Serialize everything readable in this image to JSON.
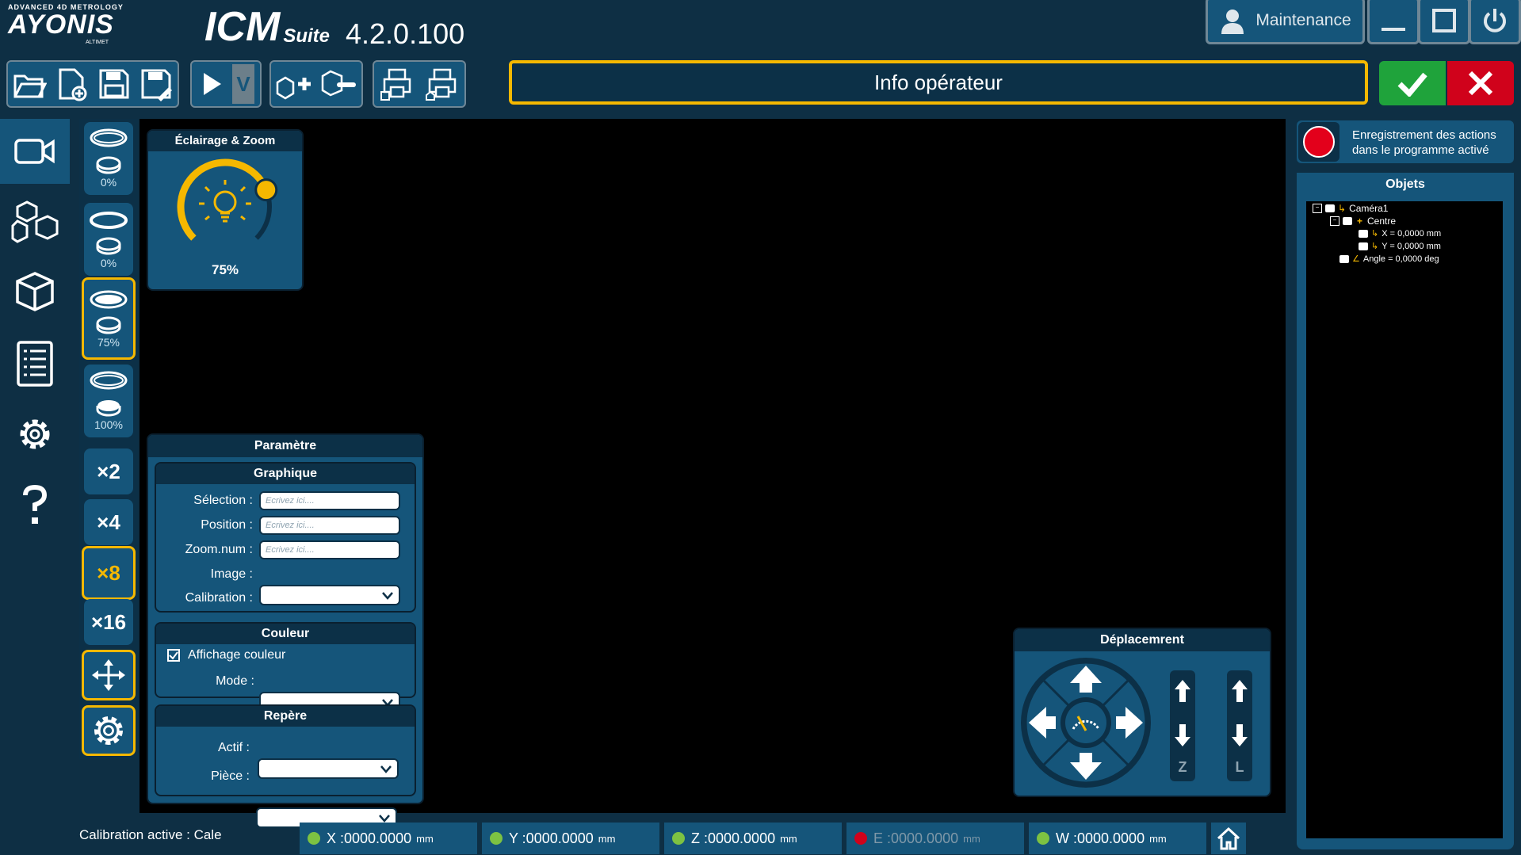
{
  "brand": {
    "tagline": "ADVANCED 4D METROLOGY",
    "logo": "AYONIS",
    "sublogo": "ALTIMET",
    "suite": "ICM",
    "suite_sub": "Suite",
    "version": "4.2.0.100"
  },
  "window": {
    "user_label": "Maintenance"
  },
  "toolbar": {
    "run_version": "V"
  },
  "operator_info": "Info opérateur",
  "lighting": {
    "title": "Éclairage & Zoom",
    "level": "75%",
    "level_value": 0.75,
    "lamps": [
      "0%",
      "0%",
      "75%",
      "100%"
    ],
    "zooms": [
      "×2",
      "×4",
      "×8",
      "×16"
    ]
  },
  "params": {
    "title": "Paramètre",
    "graphique": {
      "title": "Graphique",
      "selection_label": "Sélection :",
      "position_label": "Position :",
      "zoom_label": "Zoom.num :",
      "image_label": "Image :",
      "calibration_label": "Calibration :",
      "placeholder": "Ecrivez ici...."
    },
    "couleur": {
      "title": "Couleur",
      "affichage_label": "Affichage couleur",
      "mode_label": "Mode :"
    },
    "repere": {
      "title": "Repère",
      "actif_label": "Actif :",
      "piece_label": "Pièce :"
    }
  },
  "move": {
    "title": "Déplacemrent",
    "z_label": "Z",
    "l_label": "L"
  },
  "recording": {
    "line1": "Enregistrement des actions",
    "line2": "dans le programme activé"
  },
  "objects": {
    "title": "Objets",
    "items": [
      "Caméra1",
      "Centre",
      "X = 0,0000 mm",
      "Y = 0,0000 mm",
      "Angle = 0,0000 deg"
    ]
  },
  "statusbar": {
    "calibration": "Calibration active : Cale",
    "unit": "mm",
    "axes": [
      {
        "label": "X :0000.0000",
        "color": "#7dc242"
      },
      {
        "label": "Y :0000.0000",
        "color": "#7dc242"
      },
      {
        "label": "Z :0000.0000",
        "color": "#7dc242"
      },
      {
        "label": "E :0000.0000",
        "color": "#d0021b"
      },
      {
        "label": "W :0000.0000",
        "color": "#7dc242"
      }
    ]
  },
  "colors": {
    "accent": "#f5b800",
    "panel": "#15557a",
    "background": "#0e2f44",
    "ok": "#1fa33b",
    "cancel": "#d0021b"
  }
}
